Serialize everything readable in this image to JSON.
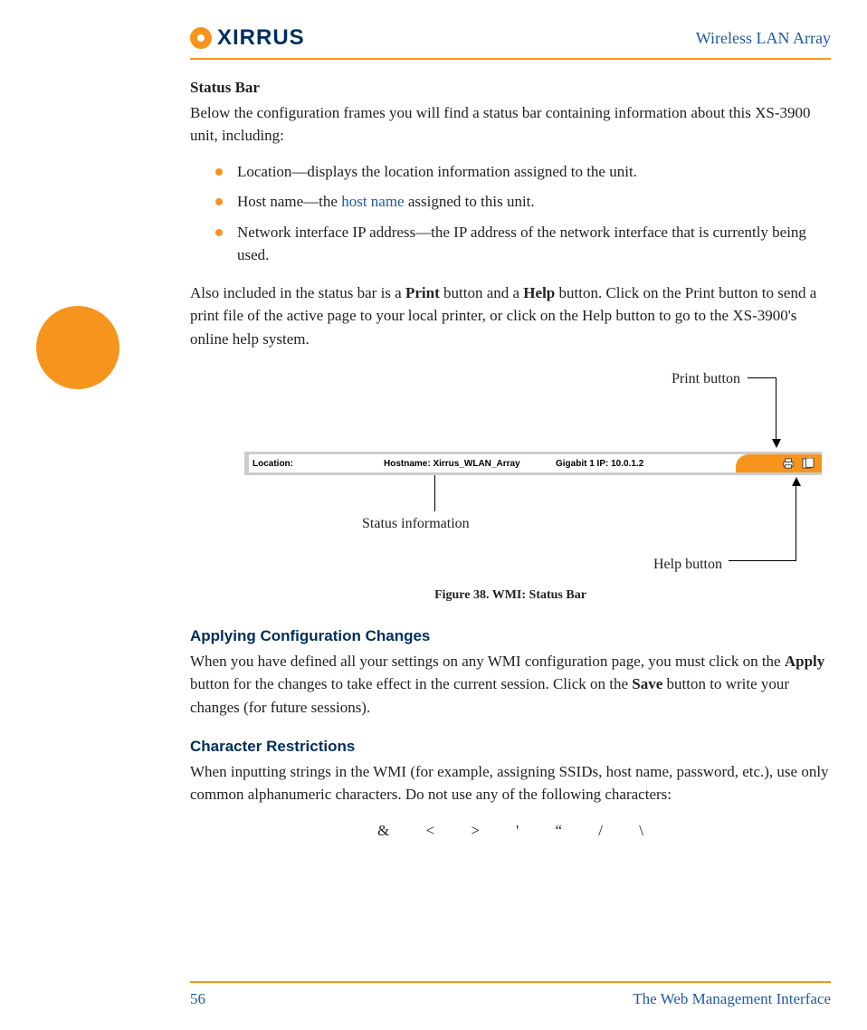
{
  "header": {
    "logo_text": "XIRRUS",
    "doc_title": "Wireless LAN Array"
  },
  "status_bar_section": {
    "heading": "Status Bar",
    "intro": "Below the configuration frames you will find a status bar containing information about this XS-3900 unit, including:",
    "bullets": [
      {
        "text_before": "Location—displays the location information assigned to the unit."
      },
      {
        "text_before": "Host name—the ",
        "link": "host name",
        "text_after": " assigned to this unit."
      },
      {
        "text_before": "Network interface IP address—the IP address of the network interface that is currently being used."
      }
    ],
    "para2_a": "Also included in the status bar is a ",
    "para2_b": "Print",
    "para2_c": " button and a ",
    "para2_d": "Help",
    "para2_e": " button. Click on the Print button to send a print file of the active page to your local printer, or click on the Help button to go to the XS-3900's online help system."
  },
  "figure": {
    "annot_print": "Print button",
    "annot_status": "Status information",
    "annot_help": "Help button",
    "sb_location_label": "Location:",
    "sb_hostname_label": "Hostname: Xirrus_WLAN_Array",
    "sb_ip_label": "Gigabit 1 IP: 10.0.1.2",
    "caption": "Figure 38. WMI: Status Bar"
  },
  "apply_section": {
    "heading": "Applying Configuration Changes",
    "para_a": "When you have defined all your settings on any WMI configuration page, you must click on the ",
    "para_b": "Apply",
    "para_c": " button for the changes to take effect in the current session. Click on the ",
    "para_d": "Save",
    "para_e": " button to write your changes (for future sessions)."
  },
  "char_section": {
    "heading": "Character Restrictions",
    "para": "When inputting strings in the WMI (for example, assigning SSIDs, host name, password, etc.), use only common alphanumeric characters. Do not use any of the following characters:",
    "chars": "& < > ' “ / \\"
  },
  "footer": {
    "page_num": "56",
    "chapter": "The Web Management Interface"
  }
}
